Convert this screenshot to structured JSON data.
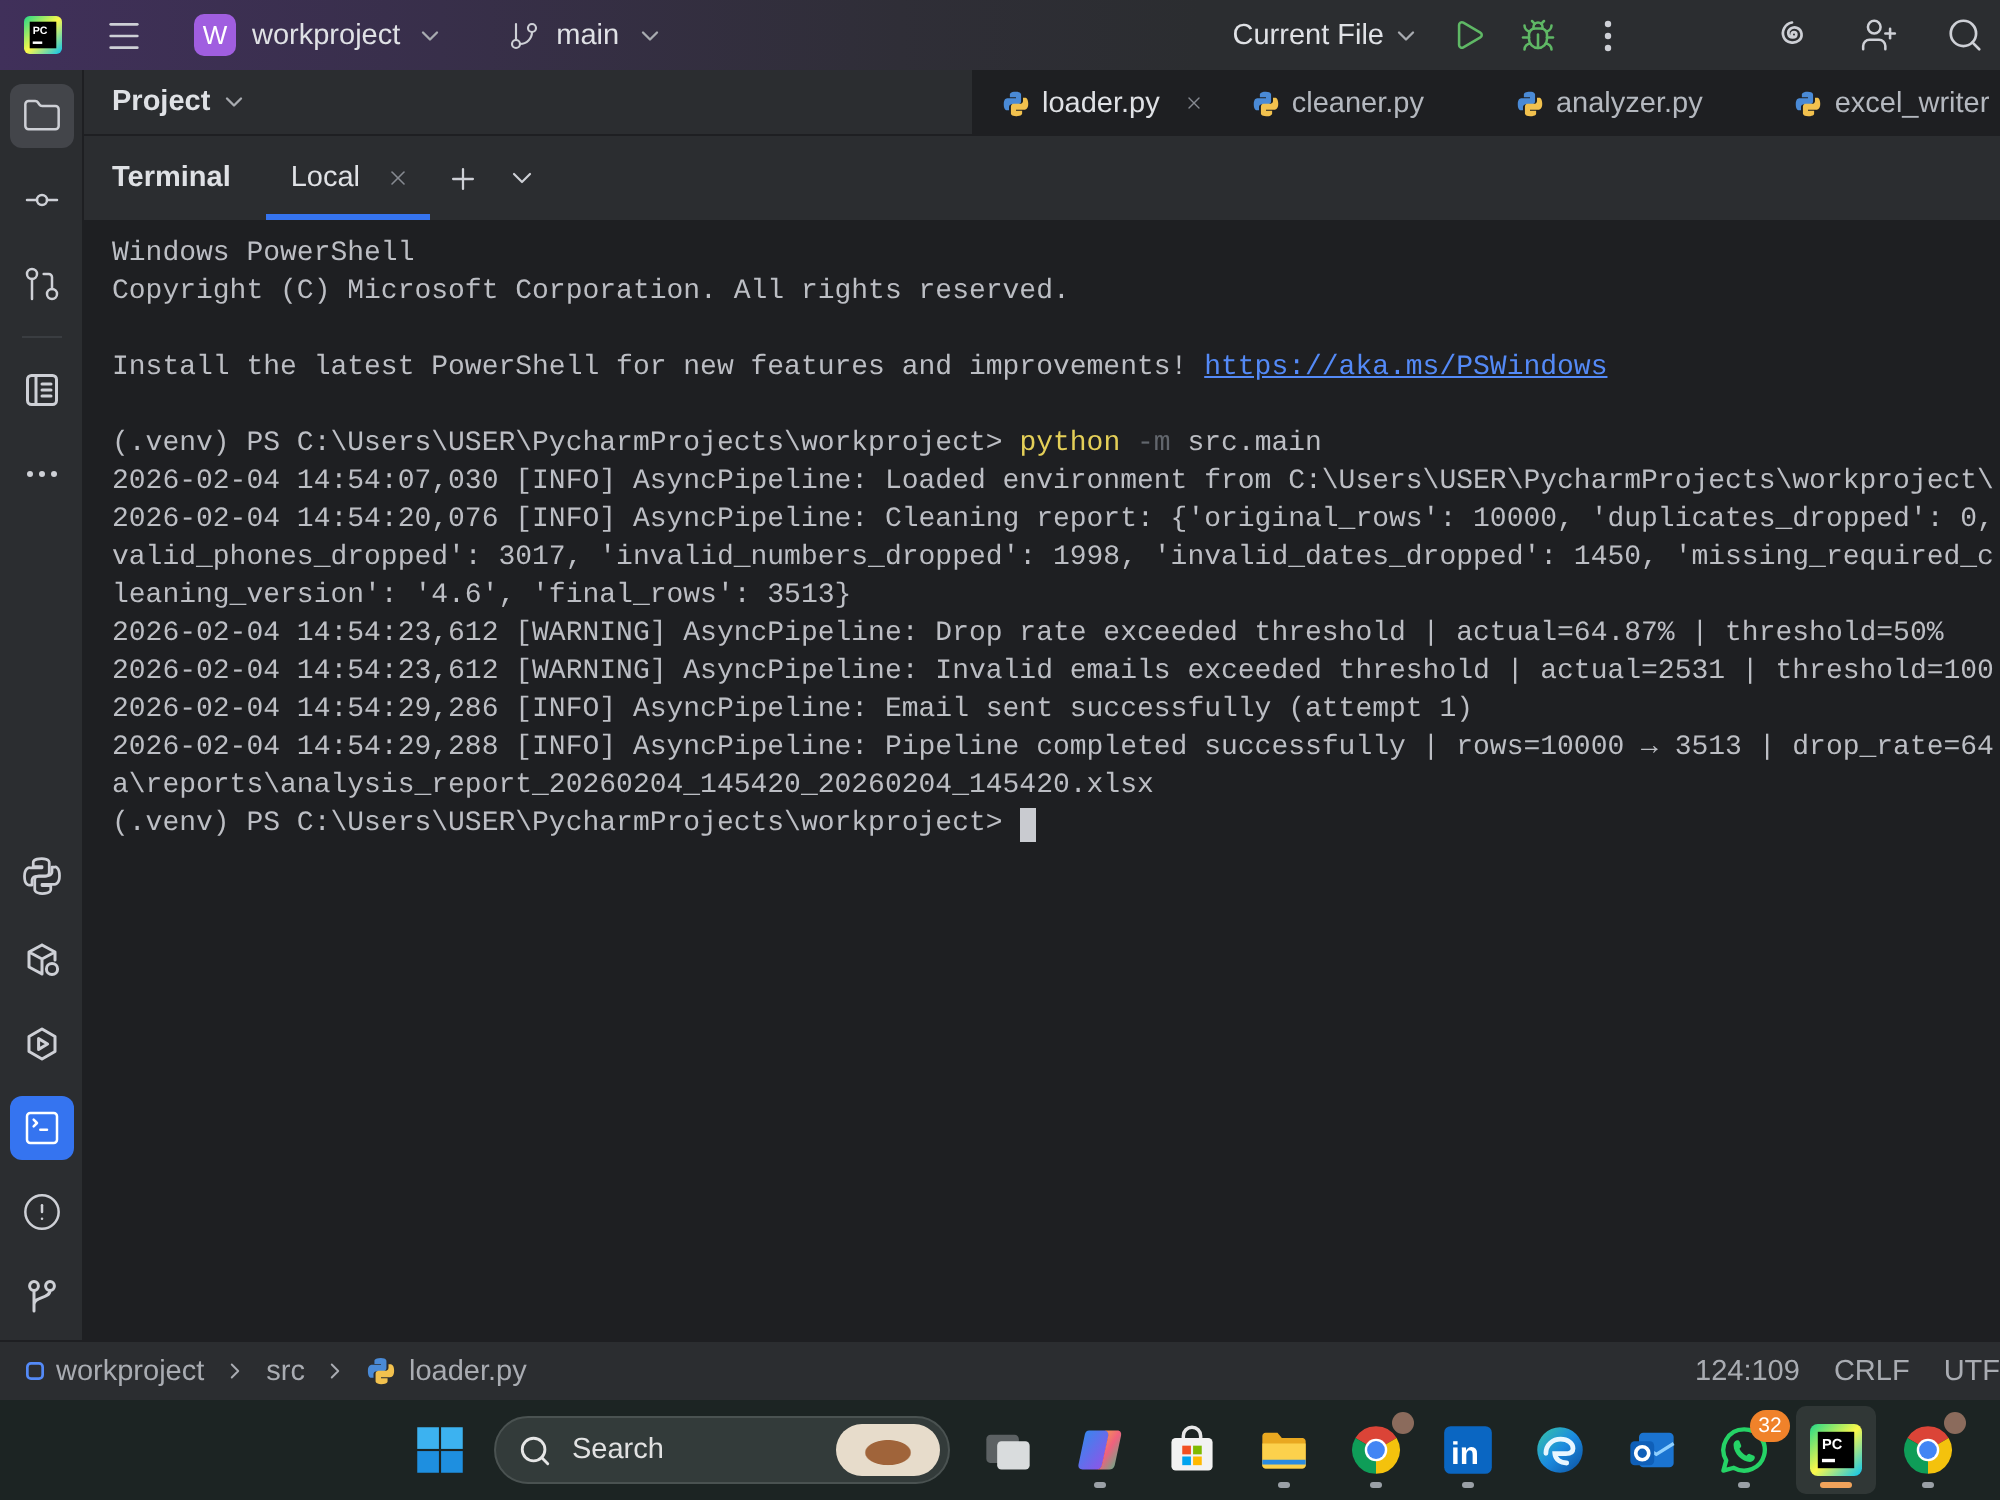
{
  "title_bar": {
    "logo": "PC",
    "project": {
      "initial": "W",
      "name": "workproject"
    },
    "branch": "main",
    "run_configuration": "Current File"
  },
  "sidebar": {
    "top_groups": [
      [
        {
          "kind": "folder",
          "selected": true,
          "focused": false
        },
        {
          "kind": "commit",
          "selected": false,
          "focused": false
        },
        {
          "kind": "merge",
          "selected": false,
          "focused": false
        }
      ],
      [
        {
          "kind": "structure",
          "selected": false,
          "focused": false
        },
        {
          "kind": "more",
          "selected": false,
          "focused": false
        }
      ]
    ],
    "bottom": [
      {
        "kind": "python",
        "selected": false,
        "focused": false
      },
      {
        "kind": "packages",
        "selected": false,
        "focused": false
      },
      {
        "kind": "services",
        "selected": false,
        "focused": false
      },
      {
        "kind": "terminal",
        "selected": true,
        "focused": true
      },
      {
        "kind": "problems",
        "selected": false,
        "focused": false
      },
      {
        "kind": "git",
        "selected": false,
        "focused": false
      }
    ]
  },
  "project_panel": {
    "title": "Project"
  },
  "editor_tabs": [
    {
      "label": "loader.py",
      "selected": true
    },
    {
      "label": "cleaner.py",
      "selected": false
    },
    {
      "label": "analyzer.py",
      "selected": false
    },
    {
      "label": "excel_writer",
      "selected": false
    }
  ],
  "terminal": {
    "title": "Terminal",
    "tabs": [
      {
        "label": "Local",
        "selected": true
      }
    ],
    "cursor": true,
    "blocks": [
      [
        {
          "segments": [
            {
              "kind": "plain",
              "text": "Windows PowerShell"
            }
          ]
        },
        {
          "segments": [
            {
              "kind": "plain",
              "text": "Copyright (C) Microsoft Corporation. All rights reserved."
            }
          ]
        }
      ],
      [
        {
          "segments": [
            {
              "kind": "plain",
              "text": "Install the latest PowerShell for new features and improvements! "
            },
            {
              "kind": "link",
              "text": "https://aka.ms/PSWindows"
            }
          ]
        }
      ],
      [
        {
          "segments": [
            {
              "kind": "plain",
              "text": "(.venv) PS C:\\Users\\USER\\PycharmProjects\\workproject> "
            },
            {
              "kind": "command",
              "text": "python"
            },
            {
              "kind": "option",
              "text": " -m"
            },
            {
              "kind": "plain",
              "text": " src.main"
            }
          ]
        },
        {
          "segments": [
            {
              "kind": "plain",
              "text": "2026-02-04 14:54:07,030 [INFO] AsyncPipeline: Loaded environment from C:\\Users\\USER\\PycharmProjects\\workproject\\"
            }
          ]
        },
        {
          "segments": [
            {
              "kind": "plain",
              "text": "2026-02-04 14:54:20,076 [INFO] AsyncPipeline: Cleaning report: {'original_rows': 10000, 'duplicates_dropped': 0,"
            }
          ]
        },
        {
          "segments": [
            {
              "kind": "plain",
              "text": "valid_phones_dropped': 3017, 'invalid_numbers_dropped': 1998, 'invalid_dates_dropped': 1450, 'missing_required_c"
            }
          ]
        },
        {
          "segments": [
            {
              "kind": "plain",
              "text": "leaning_version': '4.6', 'final_rows': 3513}"
            }
          ]
        },
        {
          "segments": [
            {
              "kind": "plain",
              "text": "2026-02-04 14:54:23,612 [WARNING] AsyncPipeline: Drop rate exceeded threshold | actual=64.87% | threshold=50%"
            }
          ]
        },
        {
          "segments": [
            {
              "kind": "plain",
              "text": "2026-02-04 14:54:23,612 [WARNING] AsyncPipeline: Invalid emails exceeded threshold | actual=2531 | threshold=100"
            }
          ]
        },
        {
          "segments": [
            {
              "kind": "plain",
              "text": "2026-02-04 14:54:29,286 [INFO] AsyncPipeline: Email sent successfully (attempt 1)"
            }
          ]
        },
        {
          "segments": [
            {
              "kind": "plain",
              "text": "2026-02-04 14:54:29,288 [INFO] AsyncPipeline: Pipeline completed successfully | rows=10000 → 3513 | drop_rate=64"
            }
          ]
        },
        {
          "segments": [
            {
              "kind": "plain",
              "text": "a\\reports\\analysis_report_20260204_145420_20260204_145420.xlsx"
            }
          ]
        },
        {
          "segments": [
            {
              "kind": "plain",
              "text": "(.venv) PS C:\\Users\\USER\\PycharmProjects\\workproject>"
            }
          ]
        }
      ]
    ]
  },
  "status_bar": {
    "breadcrumbs": [
      {
        "kind": "module",
        "label": "workproject"
      },
      {
        "kind": "plain",
        "label": "src"
      },
      {
        "kind": "python",
        "label": "loader.py"
      }
    ],
    "position": "124:109",
    "line_separator": "CRLF",
    "encoding": "UTF"
  },
  "taskbar": {
    "search": {
      "label": "Search"
    },
    "apps": [
      {
        "kind": "taskview",
        "running": false,
        "selected": false
      },
      {
        "kind": "copilot",
        "running": true,
        "selected": false
      },
      {
        "kind": "store",
        "running": false,
        "selected": false
      },
      {
        "kind": "explorer",
        "running": true,
        "selected": false
      },
      {
        "kind": "chrome",
        "running": true,
        "selected": false
      },
      {
        "kind": "linkedin",
        "label": "in",
        "running": true,
        "selected": false
      },
      {
        "kind": "edge",
        "running": false,
        "selected": false
      },
      {
        "kind": "outlook",
        "running": false,
        "selected": false
      },
      {
        "kind": "whatsapp",
        "badge": "32",
        "running": true,
        "selected": false
      },
      {
        "kind": "pycharm",
        "label": "PC",
        "running": true,
        "selected": true
      },
      {
        "kind": "chrome",
        "running": true,
        "selected": false
      }
    ]
  }
}
